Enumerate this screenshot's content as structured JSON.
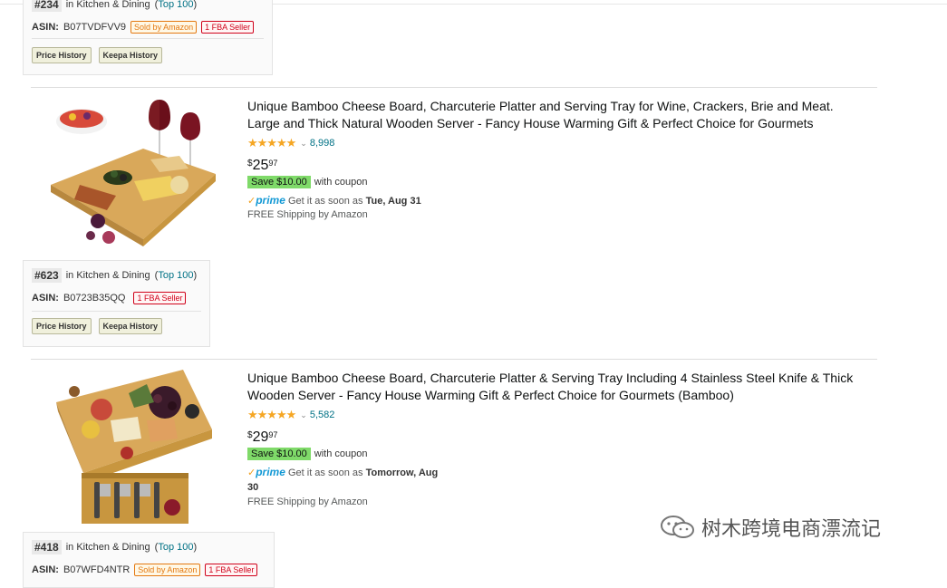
{
  "top_item": {
    "rank": "#234",
    "rank_category": "in Kitchen & Dining",
    "top_link": "Top 100",
    "asin_label": "ASIN:",
    "asin": "B07TVDFVV9",
    "badges": [
      "Sold by Amazon",
      "1 FBA Seller"
    ],
    "buttons": [
      "Price History",
      "Keepa History"
    ]
  },
  "products": [
    {
      "title_line1": "Unique Bamboo Cheese Board, Charcuterie Platter and Serving Tray for Wine, Crackers, Brie and Meat.",
      "title_line2": "Large and Thick Natural Wooden Server - Fancy House Warming Gift & Perfect Choice for Gourmets",
      "stars": "★★★★★",
      "review_count": "8,998",
      "price_symbol": "$",
      "price_whole": "25",
      "price_fraction": "97",
      "coupon_save": "Save $10.00",
      "coupon_text": "with coupon",
      "prime_label": "prime",
      "delivery_prefix": "Get it as soon as",
      "delivery_date": "Tue, Aug 31",
      "shipping": "FREE Shipping by Amazon",
      "rank": "#623",
      "rank_category": "in Kitchen & Dining",
      "top_link": "Top 100",
      "asin_label": "ASIN:",
      "asin": "B0723B35QQ",
      "badges": [
        "1 FBA Seller"
      ],
      "buttons": [
        "Price History",
        "Keepa History"
      ]
    },
    {
      "title_line1": "Unique Bamboo Cheese Board, Charcuterie Platter & Serving Tray Including 4 Stainless Steel Knife & Thick",
      "title_line2": "Wooden Server - Fancy House Warming Gift & Perfect Choice for Gourmets (Bamboo)",
      "stars": "★★★★★",
      "review_count": "5,582",
      "price_symbol": "$",
      "price_whole": "29",
      "price_fraction": "97",
      "coupon_save": "Save $10.00",
      "coupon_text": "with coupon",
      "prime_label": "prime",
      "delivery_prefix": "Get it as soon as",
      "delivery_date": "Tomorrow, Aug",
      "delivery_date_line2": "30",
      "shipping": "FREE Shipping by Amazon",
      "rank": "#418",
      "rank_category": "in Kitchen & Dining",
      "top_link": "Top 100",
      "asin_label": "ASIN:",
      "asin": "B07WFD4NTR",
      "badges": [
        "Sold by Amazon",
        "1 FBA Seller"
      ]
    }
  ],
  "watermark": "树木跨境电商漂流记",
  "colors": {
    "link": "#007185",
    "star": "#f5a623",
    "coupon_bg": "#7fda69",
    "prime_blue": "#1399d5",
    "fba_red": "#d0021b",
    "sold_orange": "#e47911"
  }
}
